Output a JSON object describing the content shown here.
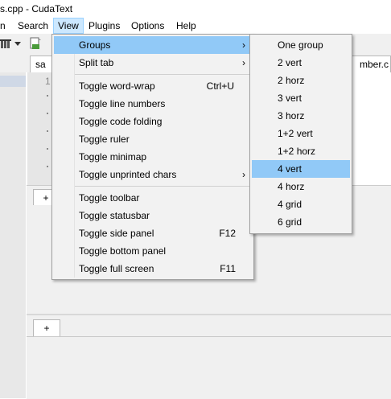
{
  "window": {
    "title": "s.cpp - CudaText"
  },
  "menubar": {
    "items": [
      {
        "label": "n"
      },
      {
        "label": "Search"
      },
      {
        "label": "View"
      },
      {
        "label": "Plugins"
      },
      {
        "label": "Options"
      },
      {
        "label": "Help"
      }
    ]
  },
  "tabs": {
    "left_tab": "sa",
    "right_tab": "mber.c"
  },
  "editor": {
    "line_number": "1"
  },
  "panels": {
    "tab1_label": "+",
    "tab2_label": "+"
  },
  "view_menu": {
    "items": [
      {
        "label": "Groups",
        "shortcut": "",
        "submenu": true,
        "highlighted": true
      },
      {
        "label": "Split tab",
        "shortcut": "",
        "submenu": true
      },
      {
        "label": "Toggle word-wrap",
        "shortcut": "Ctrl+U"
      },
      {
        "label": "Toggle line numbers",
        "shortcut": ""
      },
      {
        "label": "Toggle code folding",
        "shortcut": ""
      },
      {
        "label": "Toggle ruler",
        "shortcut": ""
      },
      {
        "label": "Toggle minimap",
        "shortcut": ""
      },
      {
        "label": "Toggle unprinted chars",
        "shortcut": "",
        "submenu": true
      },
      {
        "label": "Toggle toolbar",
        "shortcut": ""
      },
      {
        "label": "Toggle statusbar",
        "shortcut": ""
      },
      {
        "label": "Toggle side panel",
        "shortcut": "F12"
      },
      {
        "label": "Toggle bottom panel",
        "shortcut": ""
      },
      {
        "label": "Toggle full screen",
        "shortcut": "F11"
      }
    ],
    "arrow_glyph": "›"
  },
  "groups_submenu": {
    "items": [
      {
        "label": "One group"
      },
      {
        "label": "2 vert"
      },
      {
        "label": "2 horz"
      },
      {
        "label": "3 vert"
      },
      {
        "label": "3 horz"
      },
      {
        "label": "1+2 vert"
      },
      {
        "label": "1+2 horz"
      },
      {
        "label": "4 vert",
        "highlighted": true
      },
      {
        "label": "4 horz"
      },
      {
        "label": "4 grid"
      },
      {
        "label": "6 grid"
      }
    ]
  },
  "colors": {
    "highlight": "#91c9f7",
    "menu_bg": "#f2f2f2",
    "menubar_active": "#cce8ff"
  }
}
